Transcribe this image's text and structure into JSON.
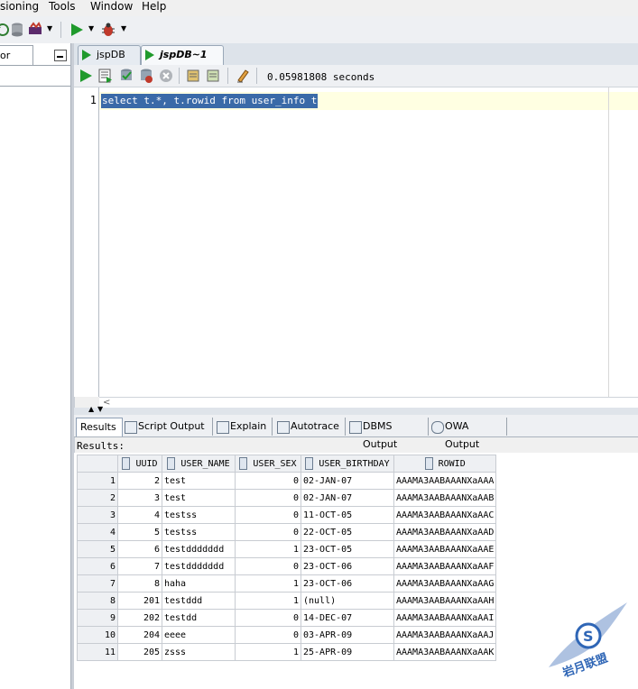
{
  "menu": {
    "items": [
      {
        "label": "sioning"
      },
      {
        "label": "Tools"
      },
      {
        "label": "Window"
      },
      {
        "label": "Help"
      }
    ]
  },
  "left_panel": {
    "tab_label": "or"
  },
  "editor_tabs": [
    {
      "label": "jspDB",
      "active": false
    },
    {
      "label": "jspDB~1",
      "active": true
    }
  ],
  "worksheet_toolbar": {
    "timing": "0.05981808 seconds"
  },
  "editor": {
    "line_number": "1",
    "sql": "select t.*, t.rowid from user_info t"
  },
  "result_tabs": [
    {
      "label": "Results",
      "active": true
    },
    {
      "label": "Script Output"
    },
    {
      "label": "Explain"
    },
    {
      "label": "Autotrace"
    },
    {
      "label": "DBMS Output"
    },
    {
      "label": "OWA Output"
    }
  ],
  "results_label": "Results:",
  "grid": {
    "columns": [
      "UUID",
      "USER_NAME",
      "USER_SEX",
      "USER_BIRTHDAY",
      "ROWID"
    ],
    "rows": [
      [
        "1",
        "2",
        "test",
        "0",
        "02-JAN-07",
        "AAAMA3AABAAANXaAAA"
      ],
      [
        "2",
        "3",
        "test",
        "0",
        "02-JAN-07",
        "AAAMA3AABAAANXaAAB"
      ],
      [
        "3",
        "4",
        "testss",
        "0",
        "11-OCT-05",
        "AAAMA3AABAAANXaAAC"
      ],
      [
        "4",
        "5",
        "testss",
        "0",
        "22-OCT-05",
        "AAAMA3AABAAANXaAAD"
      ],
      [
        "5",
        "6",
        "testddddddd",
        "1",
        "23-OCT-05",
        "AAAMA3AABAAANXaAAE"
      ],
      [
        "6",
        "7",
        "testddddddd",
        "0",
        "23-OCT-06",
        "AAAMA3AABAAANXaAAF"
      ],
      [
        "7",
        "8",
        "haha",
        "1",
        "23-OCT-06",
        "AAAMA3AABAAANXaAAG"
      ],
      [
        "8",
        "201",
        "testddd",
        "1",
        "(null)",
        "AAAMA3AABAAANXaAAH"
      ],
      [
        "9",
        "202",
        "testdd",
        "0",
        "14-DEC-07",
        "AAAMA3AABAAANXaAAI"
      ],
      [
        "10",
        "204",
        "eeee",
        "0",
        "03-APR-09",
        "AAAMA3AABAAANXaAAJ"
      ],
      [
        "11",
        "205",
        "zsss",
        "1",
        "25-APR-09",
        "AAAMA3AABAAANXaAAK"
      ]
    ]
  },
  "watermark": {
    "text": "岩月联盟"
  },
  "colors": {
    "selection": "#3a6aa8",
    "current_line": "#ffffe2",
    "run_green": "#1f9a2c"
  }
}
